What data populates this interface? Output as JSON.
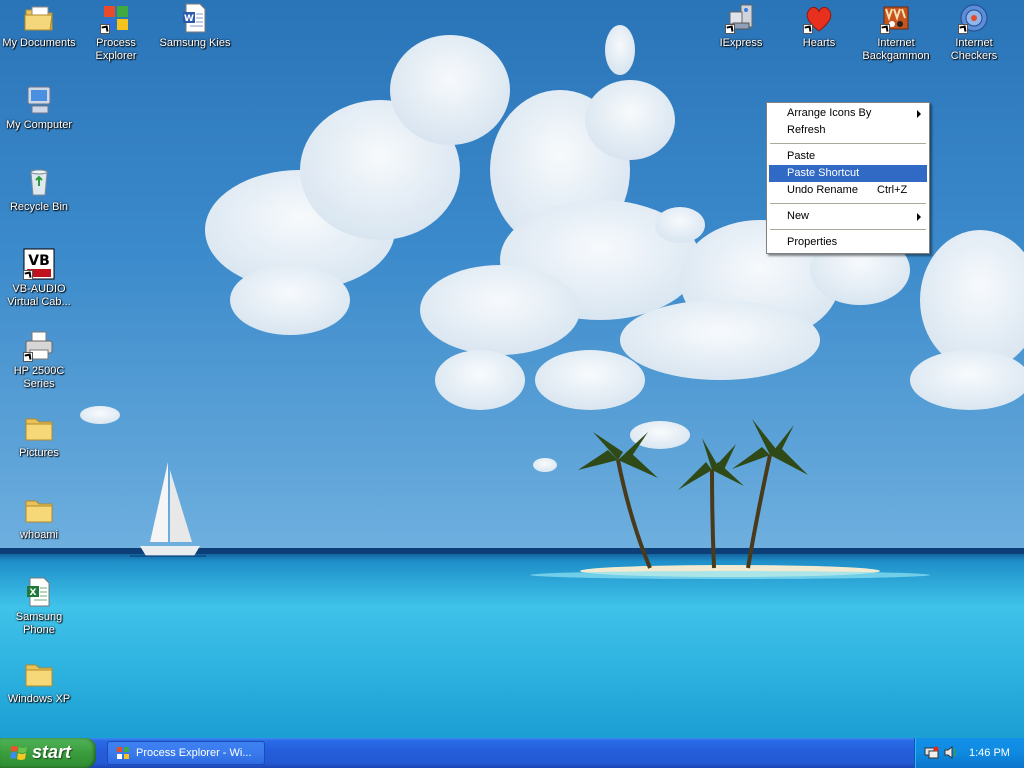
{
  "desktop": {
    "icons": [
      {
        "label": "My Documents",
        "icon": "my-documents-icon",
        "shortcut": false
      },
      {
        "label": "My Computer",
        "icon": "my-computer-icon",
        "shortcut": false
      },
      {
        "label": "Recycle Bin",
        "icon": "recycle-bin-icon",
        "shortcut": false
      },
      {
        "label": "VB-AUDIO\nVirtual Cab...",
        "icon": "vb-audio-icon",
        "shortcut": true
      },
      {
        "label": "HP 2500C\nSeries",
        "icon": "printer-icon",
        "shortcut": true
      },
      {
        "label": "Pictures",
        "icon": "folder-icon",
        "shortcut": false
      },
      {
        "label": "whoami",
        "icon": "folder-icon",
        "shortcut": false
      },
      {
        "label": "Samsung\nPhone",
        "icon": "excel-document-icon",
        "shortcut": false
      },
      {
        "label": "Windows XP",
        "icon": "folder-icon",
        "shortcut": false
      },
      {
        "label": "Process\nExplorer",
        "icon": "process-explorer-icon",
        "shortcut": true
      },
      {
        "label": "Samsung Kies",
        "icon": "word-document-icon",
        "shortcut": false
      },
      {
        "label": "IExpress",
        "icon": "iexpress-icon",
        "shortcut": true
      },
      {
        "label": "Hearts",
        "icon": "hearts-icon",
        "shortcut": true
      },
      {
        "label": "Internet\nBackgammon",
        "icon": "internet-backgammon-icon",
        "shortcut": true
      },
      {
        "label": "Internet\nCheckers",
        "icon": "internet-checkers-icon",
        "shortcut": true
      }
    ]
  },
  "context_menu": {
    "arrange_icons_by": "Arrange Icons By",
    "refresh": "Refresh",
    "paste": "Paste",
    "paste_shortcut": "Paste Shortcut",
    "undo_rename": "Undo Rename",
    "undo_rename_accel": "Ctrl+Z",
    "new": "New",
    "properties": "Properties",
    "highlighted_item": "Paste Shortcut",
    "highlight_color": "#316ac5"
  },
  "taskbar": {
    "start_label": "start",
    "task_button_label": "Process Explorer - Wi...",
    "clock": "1:46 PM",
    "tray_icons": [
      "network-icon",
      "volume-icon"
    ]
  }
}
